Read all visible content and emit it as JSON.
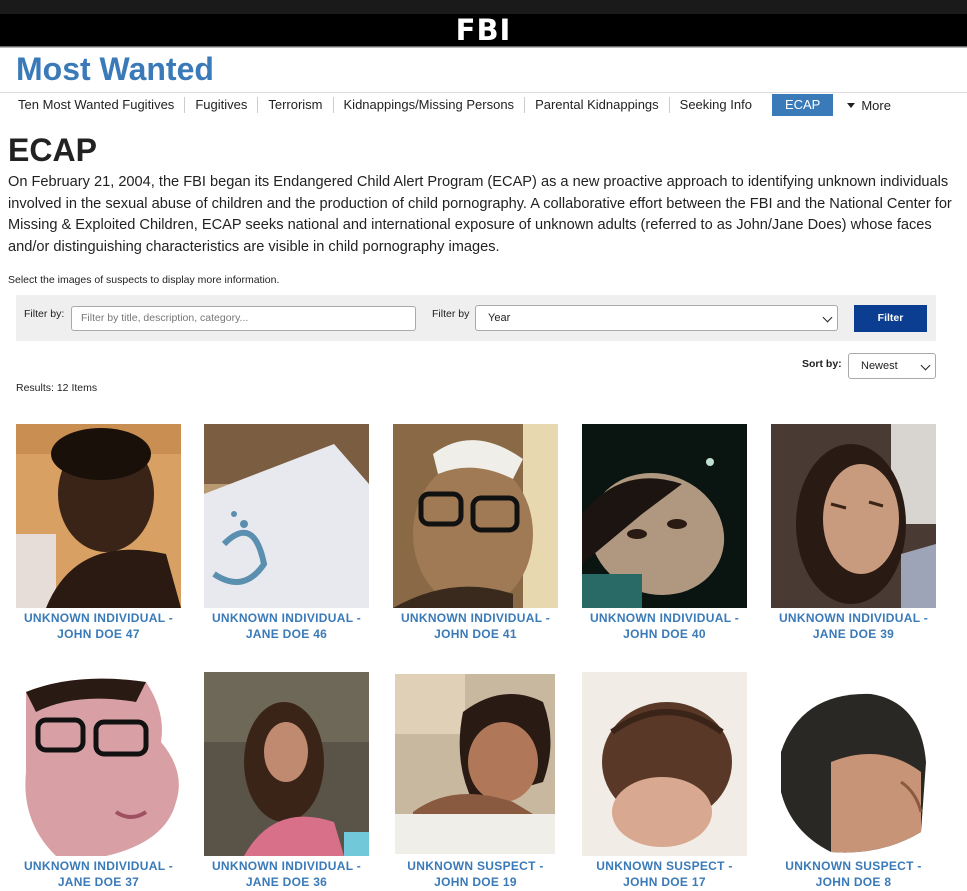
{
  "header": {
    "logo": "FBI",
    "title": "Most Wanted"
  },
  "nav": {
    "items": [
      "Ten Most Wanted Fugitives",
      "Fugitives",
      "Terrorism",
      "Kidnappings/Missing Persons",
      "Parental Kidnappings",
      "Seeking Info"
    ],
    "active": "ECAP",
    "more": "More"
  },
  "page": {
    "heading": "ECAP",
    "intro": "On February 21, 2004, the FBI began its Endangered Child Alert Program (ECAP) as a new proactive approach to identifying unknown individuals involved in the sexual abuse of children and the production of child pornography. A collaborative effort between the FBI and the National Center for Missing & Exploited Children, ECAP seeks national and international exposure of unknown adults (referred to as John/Jane Does) whose faces and/or distinguishing characteristics are visible in child pornography images.",
    "hint": "Select the images of suspects to display more information."
  },
  "filter": {
    "label1": "Filter by:",
    "placeholder": "Filter by title, description, category...",
    "label2": "Filter by",
    "select": "Year",
    "button": "Filter"
  },
  "sort": {
    "label": "Sort by:",
    "value": "Newest"
  },
  "results": "Results: 12 Items",
  "colors": {
    "accent": "#3a7ab8",
    "button": "#0b3d91",
    "header": "#000000"
  },
  "cards": [
    {
      "line1": "UNKNOWN INDIVIDUAL -",
      "line2": "JOHN DOE 47"
    },
    {
      "line1": "UNKNOWN INDIVIDUAL -",
      "line2": "JANE DOE 46"
    },
    {
      "line1": "UNKNOWN INDIVIDUAL -",
      "line2": "JOHN DOE 41"
    },
    {
      "line1": "UNKNOWN INDIVIDUAL -",
      "line2": "JOHN DOE 40"
    },
    {
      "line1": "UNKNOWN INDIVIDUAL -",
      "line2": "JANE DOE 39"
    },
    {
      "line1": "UNKNOWN INDIVIDUAL -",
      "line2": "JANE DOE 37"
    },
    {
      "line1": "UNKNOWN INDIVIDUAL -",
      "line2": "JANE DOE 36"
    },
    {
      "line1": "UNKNOWN SUSPECT -",
      "line2": "JOHN DOE 19"
    },
    {
      "line1": "UNKNOWN SUSPECT -",
      "line2": "JOHN DOE 17"
    },
    {
      "line1": "UNKNOWN SUSPECT -",
      "line2": "JOHN DOE 8"
    }
  ]
}
